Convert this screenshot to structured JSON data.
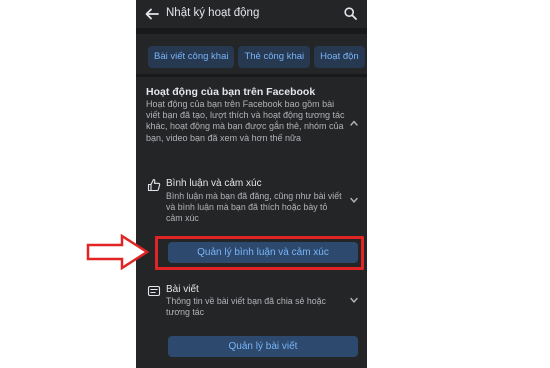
{
  "header": {
    "title": "Nhật ký hoạt động"
  },
  "chips": [
    "Bài viết công khai",
    "Thẻ công khai",
    "Hoạt độn"
  ],
  "section": {
    "title": "Hoạt động của bạn trên Facebook",
    "description": "Hoạt động của bạn trên Facebook bao gồm bài viết bạn đã tạo, lượt thích và hoạt động tương tác khác, hoạt động mà bạn được gắn thẻ, nhóm của bạn, video bạn đã xem và hơn thế nữa"
  },
  "items": [
    {
      "title": "Bình luận và cảm xúc",
      "description": "Bình luận mà bạn đã đăng, cũng như bài viết và bình luận mà bạn đã thích hoặc bày tỏ cảm xúc",
      "button": "Quản lý bình luận và cảm xúc",
      "icon": "thumbs-up-icon"
    },
    {
      "title": "Bài viết",
      "description": "Thông tin về bài viết bạn đã chia sẻ hoặc tương tác",
      "button": "Quản lý bài viết",
      "icon": "post-icon"
    }
  ],
  "colors": {
    "highlight": "#e32424",
    "accent": "#7ab4f7",
    "background": "#242526"
  }
}
